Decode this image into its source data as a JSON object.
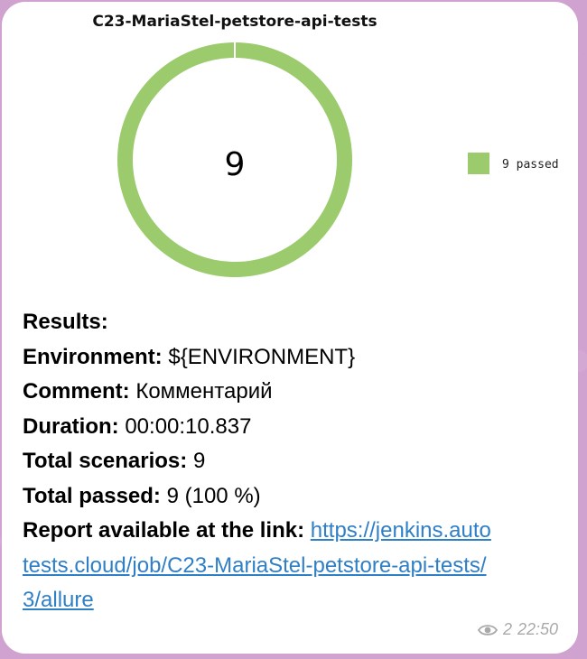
{
  "chart_data": {
    "type": "pie",
    "title": "C23-MariaStel-petstore-api-tests",
    "center_label": "9",
    "slices": [
      {
        "name": "9 passed",
        "value": 9,
        "color": "#9bcb6c"
      }
    ],
    "legend_position": "right"
  },
  "message": {
    "results_label": "Results:",
    "environment_label": "Environment:",
    "environment_value": "${ENVIRONMENT}",
    "comment_label": "Comment:",
    "comment_value": "Комментарий",
    "duration_label": "Duration:",
    "duration_value": "00:00:10.837",
    "total_scenarios_label": "Total scenarios:",
    "total_scenarios_value": "9",
    "total_passed_label": "Total passed:",
    "total_passed_value": "9 (100 %)",
    "report_label": "Report available at the link:",
    "report_link": "https://jenkins.autotests.cloud/job/C23-MariaStel-petstore-api-tests/3/allure"
  },
  "meta": {
    "views": "2",
    "time": "22:50",
    "views_icon": "eye-icon"
  },
  "colors": {
    "passed": "#9bcb6c",
    "link": "#2f7fc7",
    "meta_text": "#a9a9a9"
  }
}
